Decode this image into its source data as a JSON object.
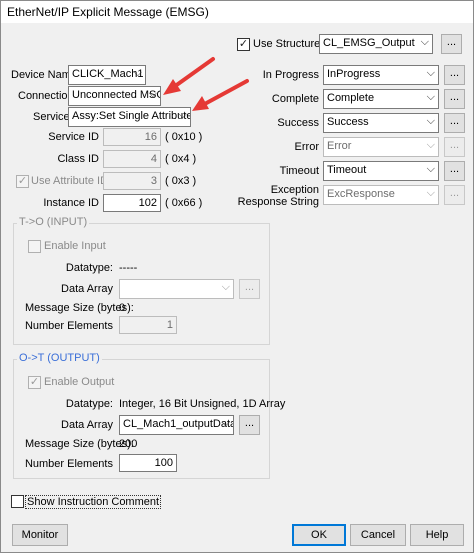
{
  "window": {
    "title": "EtherNet/IP Explicit Message (EMSG)"
  },
  "structure": {
    "use_structure_label": "Use Structure",
    "use_structure_checked": true,
    "value": "CL_EMSG_Output",
    "ellipsis": "..."
  },
  "left": {
    "device_name_label": "Device Name",
    "device_name_value": "CLICK_Mach1",
    "connection_label": "Connection",
    "connection_value": "Unconnected MSG",
    "service_label": "Service",
    "service_value": "Assy:Set Single Attribute",
    "service_id_label": "Service ID",
    "service_id_value": "16",
    "service_id_hex": "( 0x10 )",
    "class_id_label": "Class ID",
    "class_id_value": "4",
    "class_id_hex": "( 0x4 )",
    "use_attr_label": "Use Attribute ID",
    "use_attr_checked": true,
    "attr_value": "3",
    "attr_hex": "( 0x3 )",
    "instance_id_label": "Instance ID",
    "instance_id_value": "102",
    "instance_id_hex": "( 0x66 )"
  },
  "status": {
    "in_progress_label": "In Progress",
    "in_progress_value": "InProgress",
    "complete_label": "Complete",
    "complete_value": "Complete",
    "success_label": "Success",
    "success_value": "Success",
    "error_label": "Error",
    "error_value": "Error",
    "timeout_label": "Timeout",
    "timeout_value": "Timeout",
    "exception_label_1": "Exception",
    "exception_label_2": "Response String",
    "exception_value": "ExcResponse",
    "ellipsis": "..."
  },
  "input": {
    "title": "T->O (INPUT)",
    "enable_label": "Enable Input",
    "datatype_label": "Datatype:",
    "datatype_value": "-----",
    "data_array_label": "Data Array",
    "data_array_value": "",
    "msg_size_label": "Message Size (bytes):",
    "msg_size_value": "0",
    "num_elements_label": "Number Elements",
    "num_elements_value": "1",
    "ellipsis": "..."
  },
  "output": {
    "title": "O->T (OUTPUT)",
    "enable_label": "Enable Output",
    "enable_checked": true,
    "datatype_label": "Datatype:",
    "datatype_value": "Integer, 16 Bit Unsigned, 1D Array",
    "data_array_label": "Data Array",
    "data_array_value": "CL_Mach1_outputData",
    "msg_size_label": "Message Size (bytes):",
    "msg_size_value": "200",
    "num_elements_label": "Number Elements",
    "num_elements_value": "100",
    "ellipsis": "..."
  },
  "footer": {
    "show_comment_label": "Show Instruction Comment",
    "monitor": "Monitor",
    "ok": "OK",
    "cancel": "Cancel",
    "help": "Help"
  },
  "colors": {
    "arrow": "#e53935",
    "accent": "#3b6fd8",
    "default_button_border": "#0078d7"
  },
  "icons": {
    "dropdown": "chevron-down-icon",
    "checkbox_mark": "check-icon",
    "annotation": "red-arrow"
  }
}
